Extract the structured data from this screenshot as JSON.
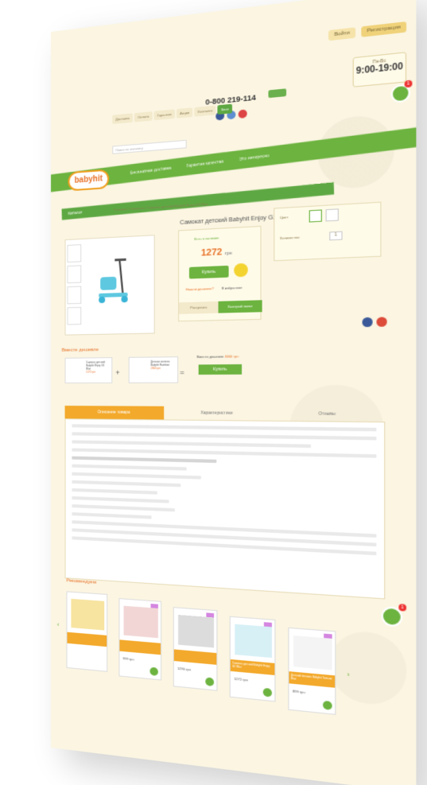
{
  "header": {
    "login_label": "Войти",
    "register_label": "Регистрация",
    "phone": "0-800 219-114",
    "hours_label": "Пн-Вс",
    "hours": "9:00-19:00",
    "nav": [
      "Доставка",
      "Оплата",
      "Гарантия",
      "Акции",
      "Контакты",
      "Блог"
    ],
    "search_placeholder": "Поиск по каталогу",
    "ribbon_items": [
      "Бесплатная доставка",
      "Гарантия качества",
      "Это интересно"
    ],
    "logo": "babyhit",
    "cart_count": "1"
  },
  "catalog_label": "Каталог",
  "breadcrumb": "Главная / Самокаты / Самокат детский Babyhit Enjoy G2 Blue",
  "product": {
    "title": "Самокат детский Babyhit Enjoy G2 Blue",
    "availability": "Есть в наличии",
    "price": "1272",
    "currency": "грн",
    "buy_label": "Купить",
    "cheaper_label": "Нашли дешевле?",
    "favorite_label": "В избранное",
    "tab_installment": "Рассрочка",
    "tab_credit": "Быстрый заказ",
    "color_label": "Цвет",
    "qty_label": "Количество",
    "qty_value": "1"
  },
  "set": {
    "title": "Вместе дешевле",
    "item1": "Самокат детский Babyhit Enjoy G2 Blue",
    "item1_price": "1272 грн",
    "item2": "Детская коляска Babyhit Rainbow",
    "item2_price": "2900 грн",
    "total_label": "Вместе дешевле",
    "total": "4000 грн",
    "buy_label": "Купить"
  },
  "tabs": [
    "Описание товара",
    "Характеристики",
    "Отзывы"
  ],
  "description_title": "Самокат детский Babyhit Enjoy G2 Blue",
  "recommend": {
    "title": "Рекомендуем",
    "cards": [
      {
        "price": "",
        "name": ""
      },
      {
        "price": "999 грн",
        "name": ""
      },
      {
        "price": "1290 грн",
        "name": ""
      },
      {
        "price": "1272 грн",
        "name": "Самокат детский Babyhit Enjoy G2 Blue"
      },
      {
        "price": "899 грн",
        "name": "Детский беговел Babyhit Tomson Blue"
      }
    ]
  },
  "colors": {
    "accent_green": "#6cb33f",
    "accent_orange": "#f3a92b",
    "price_orange": "#e8732a",
    "background": "#fbf5e2"
  }
}
